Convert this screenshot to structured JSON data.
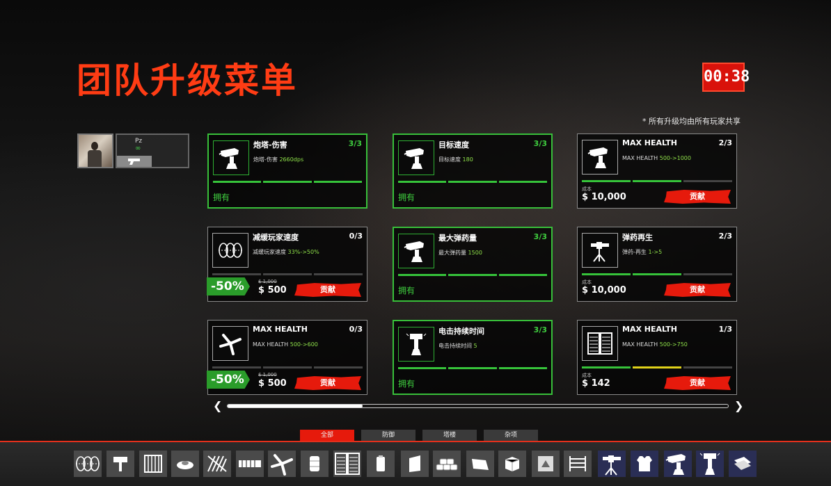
{
  "menu": {
    "title": "团队升级菜单",
    "timer": "00:38",
    "shared_note": "* 所有升级均由所有玩家共享"
  },
  "player": {
    "name": "Pz",
    "ammo": "∞"
  },
  "cards": [
    {
      "name": "炮塔-伤害",
      "level": "3/3",
      "desc_prefix": "炮塔-伤害",
      "desc_value": "2660dps",
      "desc_arrow": "",
      "desc_target": "",
      "owned": true,
      "status": "拥有",
      "icon": "turret-icon",
      "bars": [
        1,
        1,
        1
      ]
    },
    {
      "name": "目标速度",
      "level": "3/3",
      "desc_prefix": "目标速度",
      "desc_value": "180",
      "desc_arrow": "",
      "desc_target": "",
      "owned": true,
      "status": "拥有",
      "icon": "turret-icon",
      "bars": [
        1,
        1,
        1
      ]
    },
    {
      "name": "MAX HEALTH",
      "level": "2/3",
      "desc_prefix": "MAX HEALTH",
      "desc_value": "500",
      "desc_arrow": "->",
      "desc_target": "1000",
      "owned": false,
      "cost_label": "成本",
      "cost": "$ 10,000",
      "button": "贡献",
      "icon": "turret-icon",
      "bars": [
        1,
        1,
        0
      ]
    },
    {
      "name": "减缓玩家速度",
      "level": "0/3",
      "desc_prefix": "减缓玩家速度",
      "desc_value": "33%",
      "desc_arrow": "->",
      "desc_target": "50%",
      "owned": false,
      "discount": "-50%",
      "old_price": "$ 1,000",
      "new_price": "$ 500",
      "button": "贡献",
      "icon": "barbed-wire-icon",
      "bars": [
        0,
        0,
        0
      ]
    },
    {
      "name": "最大弹药量",
      "level": "3/3",
      "desc_prefix": "最大弹药量",
      "desc_value": "1500",
      "desc_arrow": "",
      "desc_target": "",
      "owned": true,
      "status": "拥有",
      "icon": "turret-icon",
      "bars": [
        1,
        1,
        1
      ]
    },
    {
      "name": "弹药再生",
      "level": "2/3",
      "desc_prefix": "弹药-再生",
      "desc_value": "1",
      "desc_arrow": "->",
      "desc_target": "5",
      "owned": false,
      "cost_label": "成本",
      "cost": "$ 10,000",
      "button": "贡献",
      "icon": "mounted-gun-icon",
      "bars": [
        1,
        1,
        0
      ]
    },
    {
      "name": "MAX HEALTH",
      "level": "0/3",
      "desc_prefix": "MAX HEALTH",
      "desc_value": "500",
      "desc_arrow": "->",
      "desc_target": "600",
      "owned": false,
      "discount": "-50%",
      "old_price": "$ 1,000",
      "new_price": "$ 500",
      "button": "贡献",
      "icon": "spike-trap-icon",
      "bars": [
        0,
        0,
        0
      ]
    },
    {
      "name": "电击持续时间",
      "level": "3/3",
      "desc_prefix": "电击持续时间",
      "desc_value": "5",
      "desc_arrow": "",
      "desc_target": "",
      "owned": true,
      "status": "拥有",
      "icon": "tesla-coil-icon",
      "bars": [
        1,
        1,
        1
      ]
    },
    {
      "name": "MAX HEALTH",
      "level": "1/3",
      "desc_prefix": "MAX HEALTH",
      "desc_value": "500",
      "desc_arrow": "->",
      "desc_target": "750",
      "owned": false,
      "cost_label": "成本",
      "cost": "$ 142",
      "button": "贡献",
      "icon": "double-door-icon",
      "bars": [
        1,
        0.5,
        0
      ]
    }
  ],
  "tabs": [
    {
      "label": "全部",
      "active": true
    },
    {
      "label": "防御",
      "active": false
    },
    {
      "label": "塔楼",
      "active": false
    },
    {
      "label": "杂项",
      "active": false
    }
  ],
  "scroll_progress": 0.27,
  "tray": [
    {
      "icon": "barbed-wire-icon",
      "kind": "defense"
    },
    {
      "icon": "sign-post-icon",
      "kind": "defense"
    },
    {
      "icon": "metal-gate-icon",
      "kind": "defense"
    },
    {
      "icon": "landmine-icon",
      "kind": "defense"
    },
    {
      "icon": "spike-barrier-icon",
      "kind": "defense"
    },
    {
      "icon": "barricade-icon",
      "kind": "defense"
    },
    {
      "icon": "spike-trap-icon",
      "kind": "defense"
    },
    {
      "icon": "barrel-icon",
      "kind": "defense"
    },
    {
      "icon": "double-door-icon",
      "kind": "defense"
    },
    {
      "icon": "canister-icon",
      "kind": "defense"
    },
    {
      "icon": "shield-panel-icon",
      "kind": "defense"
    },
    {
      "icon": "sandbag-wall-icon",
      "kind": "defense"
    },
    {
      "icon": "ramp-icon",
      "kind": "defense"
    },
    {
      "icon": "crate-icon",
      "kind": "defense"
    },
    {
      "icon": "pyramid-crate-icon",
      "kind": "defense"
    },
    {
      "icon": "fence-icon",
      "kind": "defense"
    },
    {
      "icon": "mounted-gun-icon",
      "kind": "turret"
    },
    {
      "icon": "armor-vest-icon",
      "kind": "turret"
    },
    {
      "icon": "turret-icon",
      "kind": "turret"
    },
    {
      "icon": "tesla-coil-icon",
      "kind": "turret"
    },
    {
      "icon": "cash-icon",
      "kind": "turret"
    }
  ]
}
